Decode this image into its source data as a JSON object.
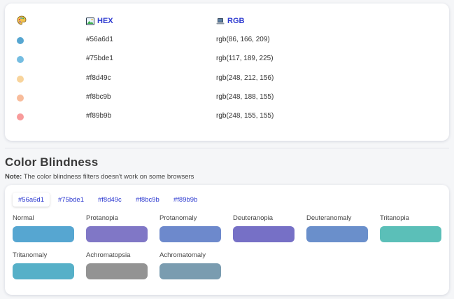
{
  "palette": {
    "hex_header": "HEX",
    "rgb_header": "RGB",
    "colors": [
      {
        "hex": "#56a6d1",
        "rgb": "rgb(86, 166, 209)",
        "swatch": "#56a6d1"
      },
      {
        "hex": "#75bde1",
        "rgb": "rgb(117, 189, 225)",
        "swatch": "#75bde1"
      },
      {
        "hex": "#f8d49c",
        "rgb": "rgb(248, 212, 156)",
        "swatch": "#f8d49c"
      },
      {
        "hex": "#f8bc9b",
        "rgb": "rgb(248, 188, 155)",
        "swatch": "#f8bc9b"
      },
      {
        "hex": "#f89b9b",
        "rgb": "rgb(248, 155, 155)",
        "swatch": "#f89b9b"
      }
    ]
  },
  "blindness": {
    "title": "Color Blindness",
    "note_label": "Note:",
    "note_text": " The color blindness filters doesn't work on some browsers",
    "tabs": [
      "#56a6d1",
      "#75bde1",
      "#f8d49c",
      "#f8bc9b",
      "#f89b9b"
    ],
    "active_tab": "#56a6d1",
    "simulations": [
      {
        "label": "Normal",
        "color": "#56a6d1"
      },
      {
        "label": "Protanopia",
        "color": "#8077c6"
      },
      {
        "label": "Protanomaly",
        "color": "#6d89cc"
      },
      {
        "label": "Deuteranopia",
        "color": "#7670c6"
      },
      {
        "label": "Deuteranomaly",
        "color": "#6a8fcb"
      },
      {
        "label": "Tritanopia",
        "color": "#5bbfb8"
      },
      {
        "label": "Tritanomaly",
        "color": "#56b0c8"
      },
      {
        "label": "Achromatopsia",
        "color": "#939393"
      },
      {
        "label": "Achromatomaly",
        "color": "#7a9cb0"
      }
    ]
  },
  "accent_color": "#2d3ad0"
}
